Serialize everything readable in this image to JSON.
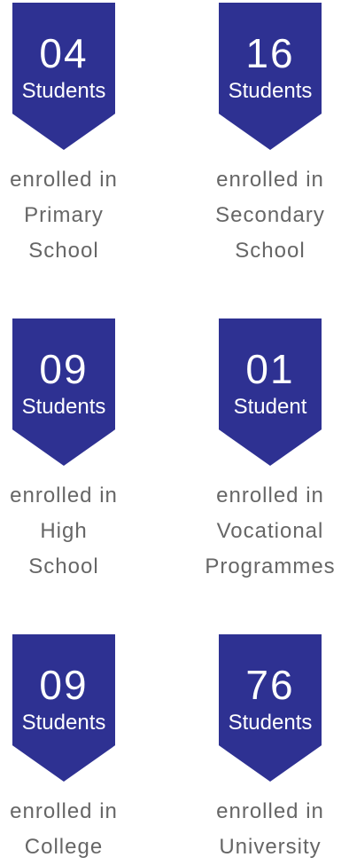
{
  "stats": [
    {
      "number": "04",
      "unit": "Students",
      "line1": "enrolled in",
      "line2": "Primary",
      "line3": "School"
    },
    {
      "number": "16",
      "unit": "Students",
      "line1": "enrolled in",
      "line2": "Secondary",
      "line3": "School"
    },
    {
      "number": "09",
      "unit": "Students",
      "line1": "enrolled in",
      "line2": "High",
      "line3": "School"
    },
    {
      "number": "01",
      "unit": "Student",
      "line1": "enrolled in",
      "line2": "Vocational",
      "line3": "Programmes"
    },
    {
      "number": "09",
      "unit": "Students",
      "line1": "enrolled in",
      "line2": "College",
      "line3": ""
    },
    {
      "number": "76",
      "unit": "Students",
      "line1": "enrolled in",
      "line2": "University",
      "line3": ""
    }
  ],
  "colors": {
    "badge": "#2e3192",
    "badge_text": "#ffffff",
    "description_text": "#666666"
  }
}
